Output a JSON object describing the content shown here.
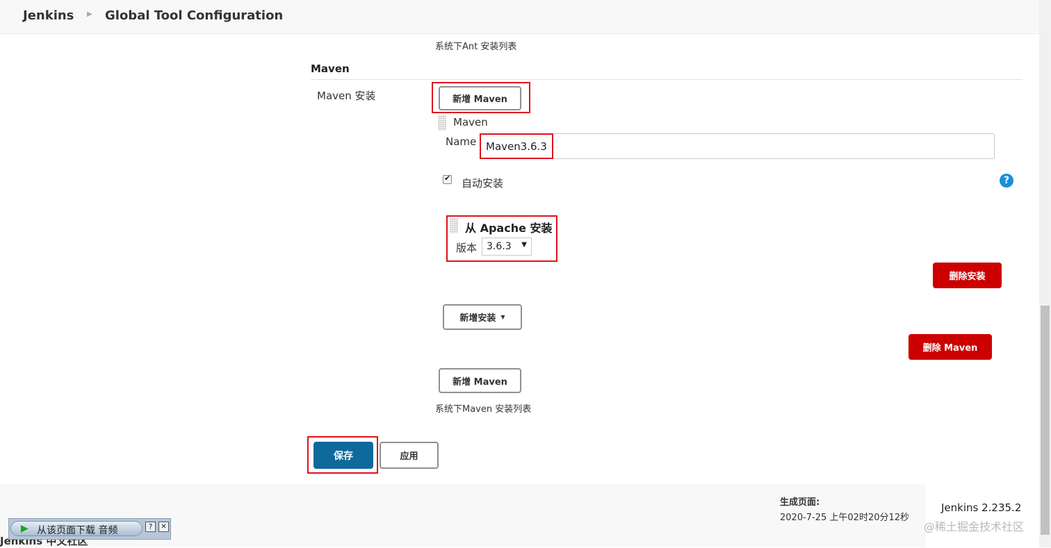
{
  "breadcrumb": {
    "home": "Jenkins",
    "page": "Global Tool Configuration"
  },
  "ant_section": {
    "list_caption": "系统下Ant 安装列表"
  },
  "maven_section": {
    "title": "Maven",
    "label": "Maven 安装",
    "add_button": "新增 Maven",
    "installation": {
      "heading": "Maven",
      "name_label": "Name",
      "name_value": "Maven3.6.3",
      "auto_install_label": "自动安装",
      "auto_install_checked": true,
      "installer": {
        "title": "从 Apache 安装",
        "version_label": "版本",
        "version_value": "3.6.3"
      },
      "delete_installer_button": "删除安装",
      "add_installer_button": "新增安装",
      "delete_maven_button": "删除 Maven"
    },
    "add_button_bottom": "新增 Maven",
    "list_caption": "系统下Maven 安装列表"
  },
  "actions": {
    "save": "保存",
    "apply": "应用"
  },
  "footer": {
    "generated_label": "生成页面:",
    "generated_time": "2020-7-25 上午02时20分12秒",
    "version": "Jenkins 2.235.2",
    "community": "Jenkins 中文社区",
    "watermark": "@稀土掘金技术社区"
  },
  "download_bar": {
    "label": "从该页面下载 音频",
    "help": "?",
    "close": "✕"
  },
  "colors": {
    "danger": "#cc0000",
    "primary": "#0e6a9c",
    "highlight": "#e3101d",
    "help": "#1a8fd6"
  },
  "icons": [
    "breadcrumb-arrow-icon",
    "drag-handle-icon",
    "checkbox-checked-icon",
    "help-icon",
    "dropdown-caret-icon",
    "play-icon",
    "close-icon"
  ]
}
